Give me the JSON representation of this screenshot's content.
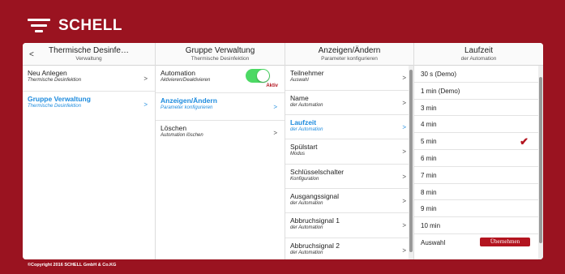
{
  "brand": {
    "name": "SCHELL"
  },
  "copyright": "©Copyright 2016 SCHELL GmbH & Co.KG",
  "columns": [
    {
      "title": "Thermische Desinfe…",
      "subtitle": "Verwaltung",
      "back": "<",
      "items": [
        {
          "title": "Neu Anlegen",
          "subtitle": "Thermische Desinfektion",
          "chevron": ">"
        },
        {
          "title": "Gruppe Verwaltung",
          "subtitle": "Thermische Desinfektion",
          "chevron": ">"
        }
      ]
    },
    {
      "title": "Gruppe Verwaltung",
      "subtitle": "Thermische Desinfektion",
      "items": [
        {
          "title": "Automation",
          "subtitle": "Aktivieren/Deaktivieren",
          "toggle_label": "Aktiv"
        },
        {
          "title": "Anzeigen/Ändern",
          "subtitle": "Parameter konfigurieren",
          "chevron": ">"
        },
        {
          "title": "Löschen",
          "subtitle": "Automation löschen",
          "chevron": ">"
        }
      ]
    },
    {
      "title": "Anzeigen/Ändern",
      "subtitle": "Parameter konfigurieren",
      "items": [
        {
          "title": "Teilnehmer",
          "subtitle": "Auswahl",
          "chevron": ">"
        },
        {
          "title": "Name",
          "subtitle": "der Automation",
          "chevron": ">"
        },
        {
          "title": "Laufzeit",
          "subtitle": "der Automation",
          "chevron": ">"
        },
        {
          "title": "Spülstart",
          "subtitle": "Modus",
          "chevron": ">"
        },
        {
          "title": "Schlüsselschalter",
          "subtitle": "Konfiguration",
          "chevron": ">"
        },
        {
          "title": "Ausgangssignal",
          "subtitle": "der Automation",
          "chevron": ">"
        },
        {
          "title": "Abbruchsignal 1",
          "subtitle": "der Automation",
          "chevron": ">"
        },
        {
          "title": "Abbruchsignal 2",
          "subtitle": "der Automation",
          "chevron": ">"
        }
      ]
    },
    {
      "title": "Laufzeit",
      "subtitle": "der Automation",
      "options": [
        "30 s (Demo)",
        "1 min (Demo)",
        "3 min",
        "4 min",
        "5 min",
        "6 min",
        "7 min",
        "8 min",
        "9 min",
        "10 min"
      ],
      "selected_index": 4,
      "check": "✔",
      "footer_label": "Auswahl",
      "apply_label": "Übernehmen"
    }
  ],
  "colors": {
    "brand": "#9a1320",
    "accent": "#1d8bde",
    "toggle_on": "#4cd964",
    "button": "#b3141f"
  }
}
